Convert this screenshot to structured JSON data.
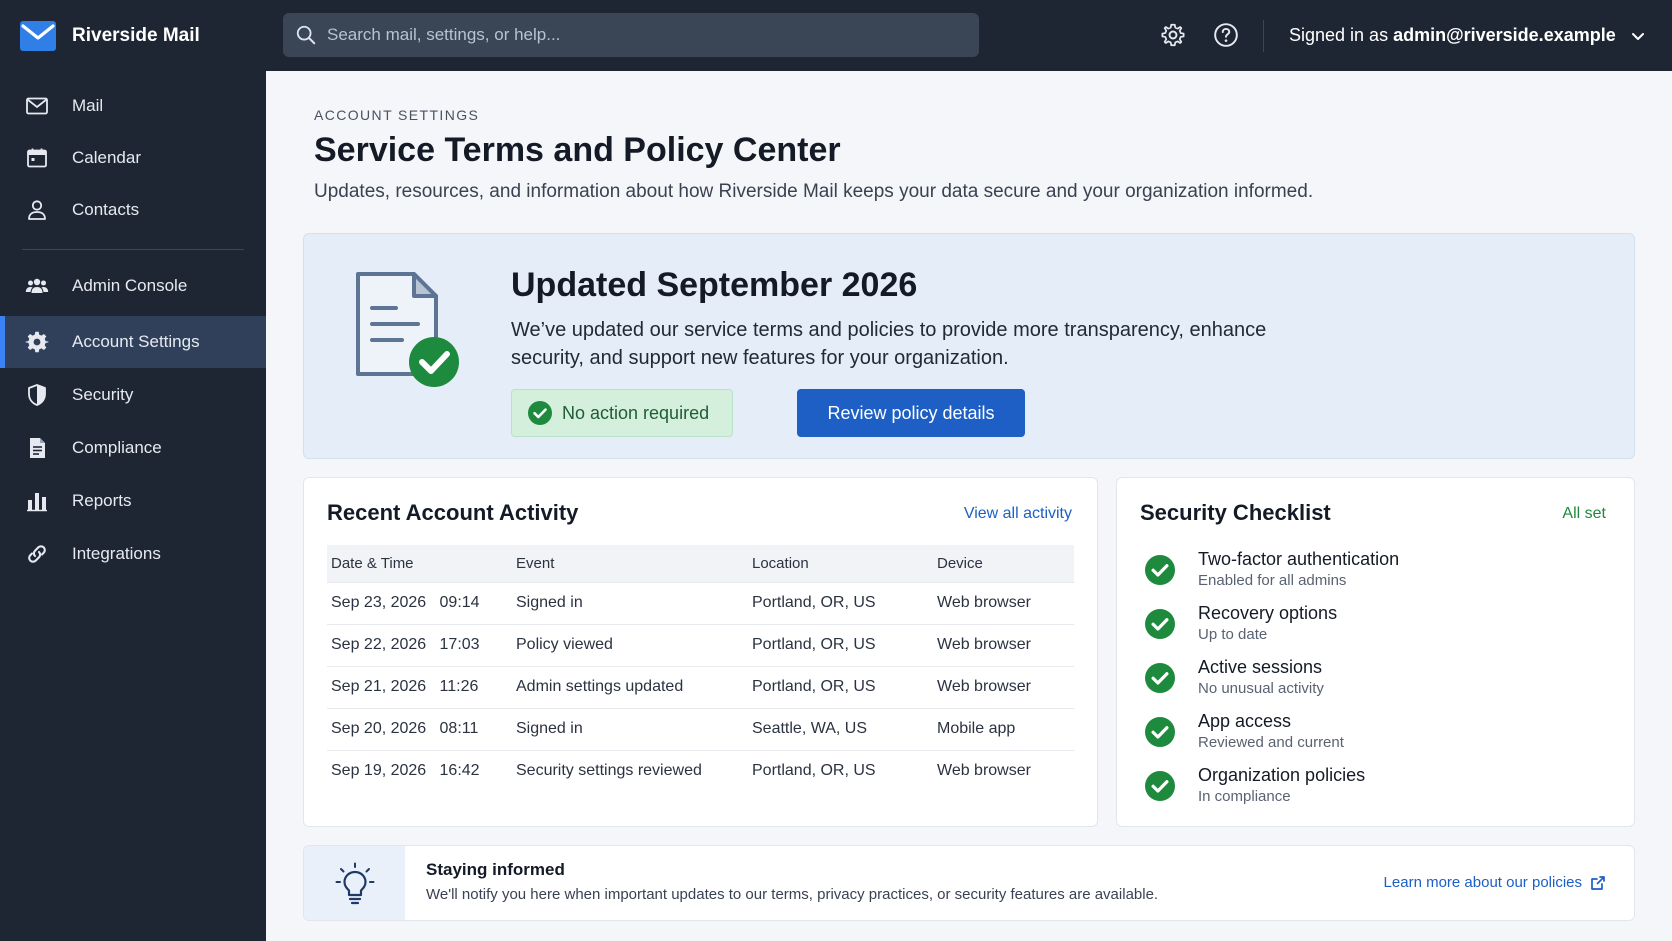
{
  "app": {
    "name": "Riverside Mail"
  },
  "search": {
    "placeholder": "Search mail, settings, or help..."
  },
  "header": {
    "signed_in_prefix": "Signed in as",
    "email": "admin@riverside.example"
  },
  "sidebar": {
    "items": [
      {
        "label": "Mail",
        "icon": "envelope-icon"
      },
      {
        "label": "Calendar",
        "icon": "calendar-icon"
      },
      {
        "label": "Contacts",
        "icon": "person-icon"
      },
      {
        "label": "Admin Console",
        "icon": "people-icon"
      },
      {
        "label": "Account Settings",
        "icon": "gear-icon",
        "active": true
      },
      {
        "label": "Security",
        "icon": "shield-icon"
      },
      {
        "label": "Compliance",
        "icon": "document-icon"
      },
      {
        "label": "Reports",
        "icon": "bar-chart-icon"
      },
      {
        "label": "Integrations",
        "icon": "link-icon"
      }
    ]
  },
  "page": {
    "eyebrow": "ACCOUNT SETTINGS",
    "title": "Service Terms and Policy Center",
    "subtitle": "Updates, resources, and information about how Riverside Mail keeps your data secure and your organization informed."
  },
  "banner": {
    "title": "Updated September 2026",
    "text": "We’ve updated our service terms and policies to provide more transparency, enhance security, and support new features for your organization.",
    "status": "No action required",
    "button": "Review policy details"
  },
  "activity": {
    "title": "Recent Account Activity",
    "link": "View all activity",
    "columns": [
      "Date & Time",
      "Event",
      "Location",
      "Device"
    ],
    "rows": [
      [
        "Sep 23, 2026   09:14",
        "Signed in",
        "Portland, OR, US",
        "Web browser"
      ],
      [
        "Sep 22, 2026   17:03",
        "Policy viewed",
        "Portland, OR, US",
        "Web browser"
      ],
      [
        "Sep 21, 2026   11:26",
        "Admin settings updated",
        "Portland, OR, US",
        "Web browser"
      ],
      [
        "Sep 20, 2026   08:11",
        "Signed in",
        "Seattle, WA, US",
        "Mobile app"
      ],
      [
        "Sep 19, 2026   16:42",
        "Security settings reviewed",
        "Portland, OR, US",
        "Web browser"
      ]
    ]
  },
  "checklist": {
    "title": "Security Checklist",
    "link": "All set",
    "items": [
      {
        "title": "Two-factor authentication",
        "sub": "Enabled for all admins"
      },
      {
        "title": "Recovery options",
        "sub": "Up to date"
      },
      {
        "title": "Active sessions",
        "sub": "No unusual activity"
      },
      {
        "title": "App access",
        "sub": "Reviewed and current"
      },
      {
        "title": "Organization policies",
        "sub": "In compliance"
      }
    ]
  },
  "info": {
    "title": "Staying informed",
    "text": "We'll notify you here when important updates to our terms, privacy practices, or security features are available.",
    "link": "Learn more about our policies"
  },
  "colors": {
    "accent": "#1d5fc4",
    "success": "#1e8a3e",
    "sidebar": "#1e2633",
    "sidebar_active": "#30405a"
  }
}
